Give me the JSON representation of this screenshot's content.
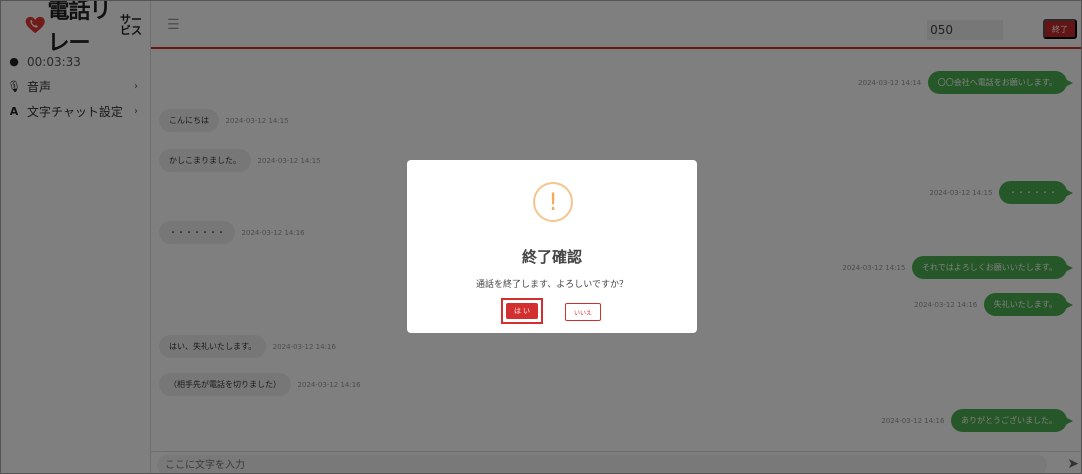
{
  "logo": {
    "text": "電話リレー",
    "sub": "サービス"
  },
  "sidebar": {
    "timer": "00:03:33",
    "audio_label": "音声",
    "text_chat_label": "文字チャット設定"
  },
  "header": {
    "phone_prefix": "050",
    "end_label": "終了"
  },
  "messages": [
    {
      "side": "out",
      "text": "〇〇会社へ電話をお願いします。",
      "ts": "2024-03-12 14:14"
    },
    {
      "side": "in",
      "text": "こんにちは",
      "ts": "2024-03-12 14:15"
    },
    {
      "side": "in",
      "text": "かしこまりました。",
      "ts": "2024-03-12 14:15"
    },
    {
      "side": "out",
      "text": "・・・・・・",
      "ts": "2024-03-12 14:15"
    },
    {
      "side": "in",
      "text": "・・・・・・・",
      "ts": "2024-03-12 14:16"
    },
    {
      "side": "out",
      "text": "それではよろしくお願いいたします。",
      "ts": "2024-03-12 14:15"
    },
    {
      "side": "out",
      "text": "失礼いたします。",
      "ts": "2024-03-12 14:16"
    },
    {
      "side": "in",
      "text": "はい、失礼いたします。",
      "ts": "2024-03-12 14:16"
    },
    {
      "side": "in",
      "text": "（相手先が電話を切りました）",
      "ts": "2024-03-12 14:16"
    },
    {
      "side": "out",
      "text": "ありがとうございました。",
      "ts": "2024-03-12 14:16"
    }
  ],
  "input": {
    "placeholder": "ここに文字を入力"
  },
  "dialog": {
    "icon": "!",
    "title": "終了確認",
    "message": "通話を終了します、よろしいですか？",
    "yes_label": "は い",
    "no_label": "いいえ"
  },
  "colors": {
    "accent": "#d32f2f",
    "bubble_out": "#4caf50",
    "bubble_in": "#eeeeee"
  }
}
